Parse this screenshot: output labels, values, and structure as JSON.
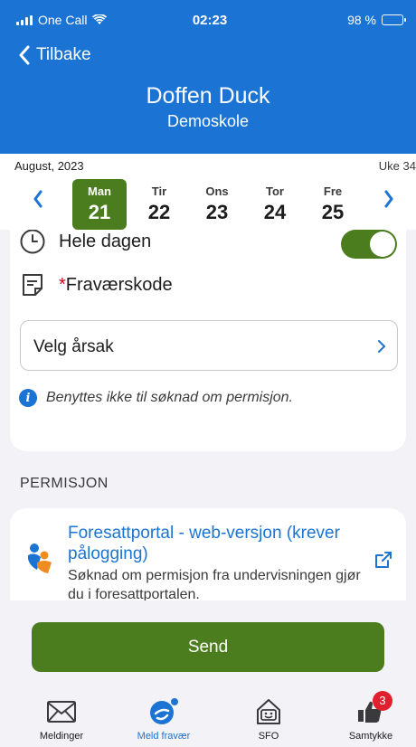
{
  "status_bar": {
    "carrier": "One Call",
    "time": "02:23",
    "battery": "98 %"
  },
  "header": {
    "back_label": "Tilbake",
    "title": "Doffen Duck",
    "subtitle": "Demoskole"
  },
  "week_picker": {
    "month": "August, 2023",
    "week": "Uke 34",
    "days": [
      {
        "name": "Man",
        "date": "21",
        "selected": true
      },
      {
        "name": "Tir",
        "date": "22"
      },
      {
        "name": "Ons",
        "date": "23"
      },
      {
        "name": "Tor",
        "date": "24"
      },
      {
        "name": "Fre",
        "date": "25"
      }
    ]
  },
  "form": {
    "all_day_label": "Hele dagen",
    "all_day_on": true,
    "absence_code_required": "*",
    "absence_code_label": "Fraværskode",
    "reason_select": "Velg årsak",
    "info_note": "Benyttes ikke til søknad om permisjon."
  },
  "permission": {
    "section_title": "PERMISJON",
    "link_title": "Foresattportal - web-versjon (krever pålogging)",
    "link_description": "Søknad om permisjon fra undervisningen gjør du i foresattportalen."
  },
  "send_label": "Send",
  "tabbar": {
    "items": [
      {
        "label": "Meldinger",
        "icon": "envelope-icon"
      },
      {
        "label": "Meld fravær",
        "icon": "report-absence-icon",
        "active": true
      },
      {
        "label": "SFO",
        "icon": "sfo-house-icon"
      },
      {
        "label": "Samtykke",
        "icon": "thumbs-up-icon",
        "badge": "3"
      }
    ]
  },
  "colors": {
    "primary_blue": "#1b74d3",
    "green": "#4b7d1e",
    "badge_red": "#e0202e"
  }
}
